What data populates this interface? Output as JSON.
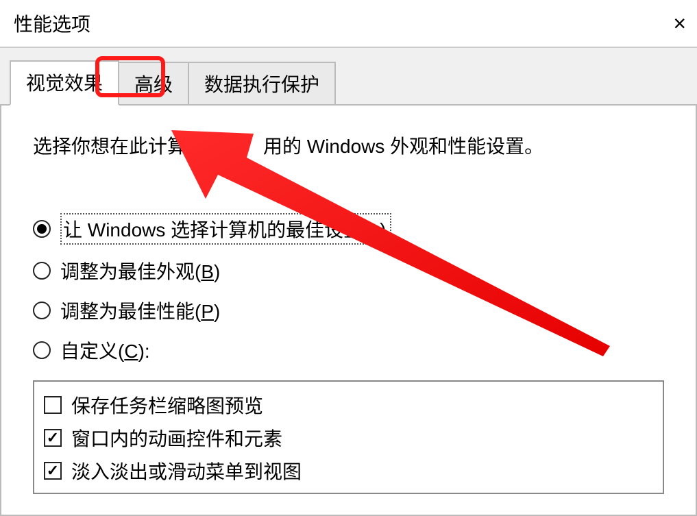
{
  "title": "性能选项",
  "tabs": {
    "visual_effects": "视觉效果",
    "advanced": "高级",
    "dep": "数据执行保护"
  },
  "description": "选择你想在此计算机　　　用的 Windows 外观和性能设置。",
  "radios": {
    "let_windows": {
      "prefix": "让 Windows 选择计算机的最佳设置(",
      "key": "L",
      "suffix": ")"
    },
    "best_appearance": {
      "prefix": "调整为最佳外观(",
      "key": "B",
      "suffix": ")"
    },
    "best_performance": {
      "prefix": "调整为最佳性能(",
      "key": "P",
      "suffix": ")"
    },
    "custom": {
      "prefix": "自定义(",
      "key": "C",
      "suffix": "):"
    }
  },
  "checkboxes": {
    "taskbar_thumb": "保存任务栏缩略图预览",
    "window_anim": "窗口内的动画控件和元素",
    "fade_slide": "淡入淡出或滑动菜单到视图"
  }
}
